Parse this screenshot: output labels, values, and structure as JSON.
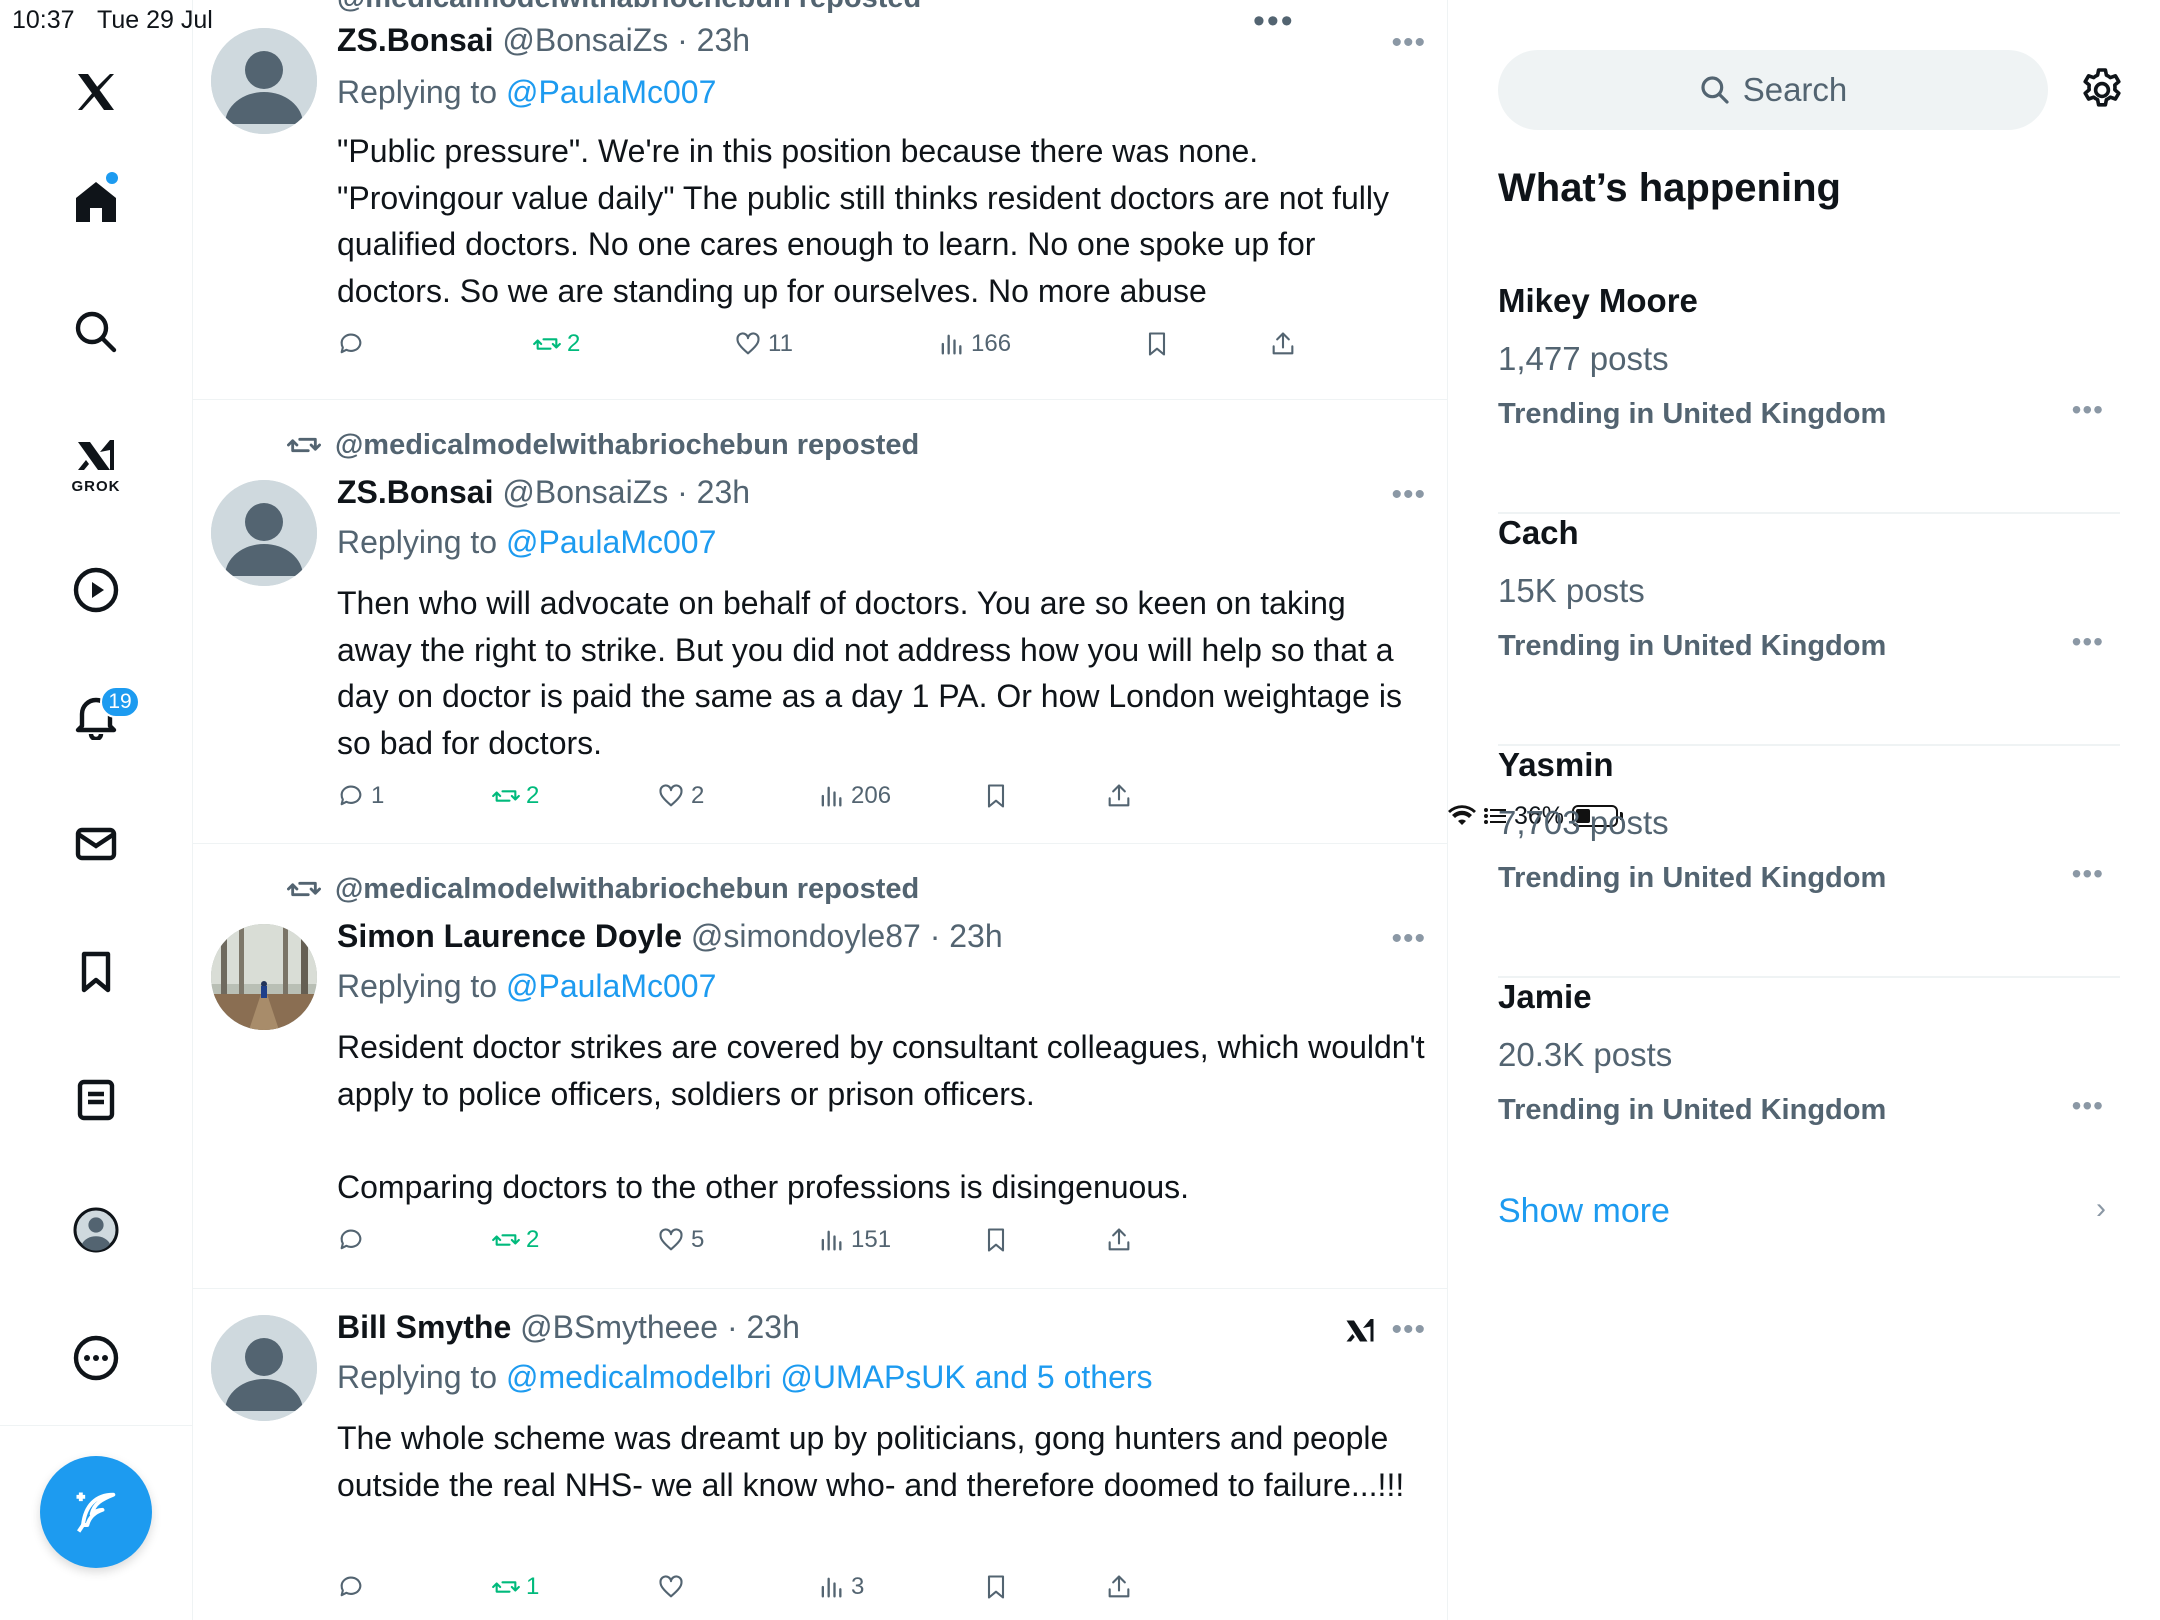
{
  "status_bar": {
    "time": "10:37",
    "date": "Tue 29 Jul",
    "battery": "36%"
  },
  "nav": {
    "grok_label": "GROK",
    "notifications_badge": "19",
    "items": [
      "x-logo",
      "home",
      "explore",
      "grok",
      "videos",
      "notifications",
      "messages",
      "bookmarks",
      "lists",
      "profile",
      "more"
    ]
  },
  "timeline": {
    "top_partial_repost": "@medicalmodelwithabriochebun reposted",
    "more_dots": "•••",
    "posts": [
      {
        "reposted_by": "",
        "name": "ZS.Bonsai",
        "handle": "@BonsaiZs · 23h",
        "replying_prefix": "Replying to ",
        "replying_to": "@PaulaMc007",
        "text": "\"Public pressure\". We're in this position because there was none. \"Provingour value daily\" The public still thinks resident doctors are not fully qualified doctors. No one cares enough to learn. No one spoke up for doctors. So we are standing up for ourselves. No more abuse",
        "replies": "",
        "reposts": "2",
        "likes": "11",
        "views": "166"
      },
      {
        "reposted_by": "@medicalmodelwithabriochebun reposted",
        "name": "ZS.Bonsai",
        "handle": "@BonsaiZs · 23h",
        "replying_prefix": "Replying to ",
        "replying_to": "@PaulaMc007",
        "text": "Then who will advocate on behalf of doctors. You are so keen on taking away the right to strike. But you did not address how you will help so that a day on doctor is paid the same as a day 1 PA. Or how London weightage is so bad for doctors.",
        "replies": "1",
        "reposts": "2",
        "likes": "2",
        "views": "206"
      },
      {
        "reposted_by": "@medicalmodelwithabriochebun reposted",
        "name": "Simon Laurence Doyle",
        "handle": "@simondoyle87 · 23h",
        "replying_prefix": "Replying to ",
        "replying_to": "@PaulaMc007",
        "text": "Resident doctor strikes are covered by consultant colleagues, which wouldn't apply to police officers, soldiers or prison officers.\n\nComparing doctors to the other professions is disingenuous.",
        "replies": "",
        "reposts": "2",
        "likes": "5",
        "views": "151"
      },
      {
        "reposted_by": "",
        "name": "Bill Smythe",
        "handle": "@BSmytheee · 23h",
        "replying_prefix": "Replying to ",
        "replying_to": "@medicalmodelbri @UMAPsUK and 5 others",
        "text": "The whole scheme was dreamt up by politicians, gong hunters and people outside the real NHS- we all know who- and therefore doomed to failure...!!!",
        "replies": "",
        "reposts": "1",
        "likes": "",
        "views": "3"
      }
    ]
  },
  "sidebar": {
    "search_placeholder": "Search",
    "section_title": "What’s happening",
    "trends": [
      {
        "name": "Mikey Moore",
        "count": "1,477 posts",
        "context": "Trending in United Kingdom"
      },
      {
        "name": "Cach",
        "count": "15K posts",
        "context": "Trending in United Kingdom"
      },
      {
        "name": "Yasmin",
        "count": "7,703 posts",
        "context": "Trending in United Kingdom"
      },
      {
        "name": "Jamie",
        "count": "20.3K posts",
        "context": "Trending in United Kingdom"
      }
    ],
    "more_dots": "•••",
    "show_more": "Show more",
    "chevron": "›"
  },
  "colors": {
    "accent": "#1d9bf0",
    "repost_green": "#00ba7c",
    "muted": "#536471",
    "text": "#0f1419"
  }
}
